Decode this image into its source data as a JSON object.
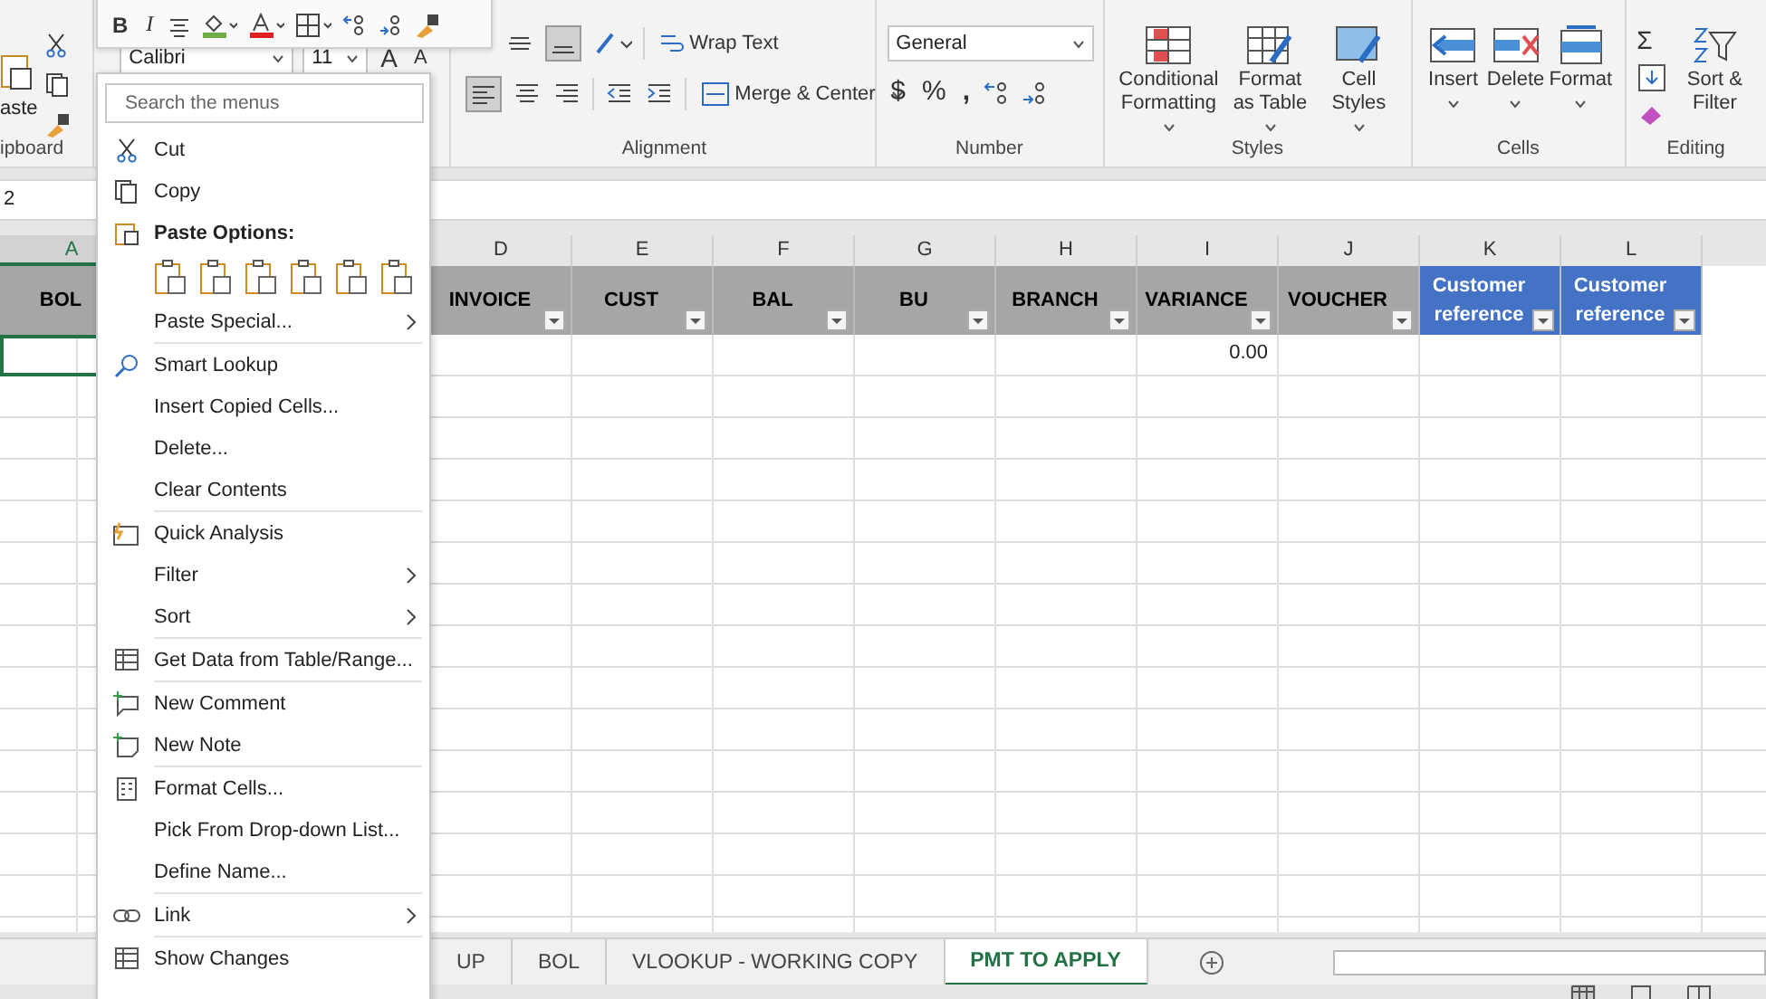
{
  "ribbon": {
    "clipboard": {
      "paste_label": "aste",
      "group_label": "ipboard"
    },
    "font": {
      "font_name": "Calibri",
      "font_size": "11",
      "grow": "A",
      "shrink": "A"
    },
    "alignment": {
      "wrap_text": "Wrap Text",
      "merge": "Merge & Center",
      "group_label": "Alignment"
    },
    "number": {
      "format": "General",
      "currency": "$",
      "percent": "%",
      "comma": ",",
      "group_label": "Number"
    },
    "styles": {
      "buttons": [
        {
          "label": "Conditional Formatting"
        },
        {
          "label": "Format as Table"
        },
        {
          "label": "Cell Styles"
        }
      ],
      "group_label": "Styles"
    },
    "cells": {
      "buttons": [
        {
          "label": "Insert"
        },
        {
          "label": "Delete"
        },
        {
          "label": "Format"
        }
      ],
      "group_label": "Cells"
    },
    "editing": {
      "sigma": "Σ",
      "sort_filter": "Sort & Filter",
      "group_label": "Editing"
    }
  },
  "mini_toolbar": {
    "bold": "B",
    "italic": "I"
  },
  "name_box": "2",
  "columns": [
    {
      "letter": "A",
      "header": "BOL",
      "color": "#a6a6a6",
      "selected": true
    },
    {
      "letter": "D",
      "header": "INVOICE",
      "color": "#a6a6a6",
      "selected": false
    },
    {
      "letter": "E",
      "header": "CUST",
      "color": "#a6a6a6",
      "selected": false
    },
    {
      "letter": "F",
      "header": "BAL",
      "color": "#a6a6a6",
      "selected": false
    },
    {
      "letter": "G",
      "header": "BU",
      "color": "#a6a6a6",
      "selected": false
    },
    {
      "letter": "H",
      "header": "BRANCH",
      "color": "#a6a6a6",
      "selected": false
    },
    {
      "letter": "I",
      "header": "VARIANCE",
      "color": "#a6a6a6",
      "selected": false,
      "value": "0.00"
    },
    {
      "letter": "J",
      "header": "VOUCHER",
      "color": "#a6a6a6",
      "selected": false
    },
    {
      "letter": "K",
      "header": "Customer reference",
      "color": "#4472c4",
      "selected": false
    },
    {
      "letter": "L",
      "header": "Customer reference",
      "color": "#4472c4",
      "selected": false
    }
  ],
  "context_menu": {
    "search_placeholder": "Search the menus",
    "sections": [
      [
        {
          "label": "Cut",
          "submenu": false,
          "kind": "item"
        },
        {
          "label": "Copy",
          "submenu": false,
          "kind": "item"
        },
        {
          "label": "Paste Options:",
          "submenu": false,
          "kind": "heading"
        },
        {
          "kind": "paste-icons"
        },
        {
          "label": "Paste Special...",
          "submenu": true,
          "kind": "item"
        }
      ],
      [
        {
          "label": "Smart Lookup",
          "submenu": false,
          "kind": "item"
        },
        {
          "label": "Insert Copied Cells...",
          "submenu": false,
          "kind": "item"
        },
        {
          "label": "Delete...",
          "submenu": false,
          "kind": "item"
        },
        {
          "label": "Clear Contents",
          "submenu": false,
          "kind": "item"
        }
      ],
      [
        {
          "label": "Quick Analysis",
          "submenu": false,
          "kind": "item"
        },
        {
          "label": "Filter",
          "submenu": true,
          "kind": "item"
        },
        {
          "label": "Sort",
          "submenu": true,
          "kind": "item"
        }
      ],
      [
        {
          "label": "Get Data from Table/Range...",
          "submenu": false,
          "kind": "item"
        }
      ],
      [
        {
          "label": "New Comment",
          "submenu": false,
          "kind": "item"
        },
        {
          "label": "New Note",
          "submenu": false,
          "kind": "item"
        }
      ],
      [
        {
          "label": "Format Cells...",
          "submenu": false,
          "kind": "item"
        },
        {
          "label": "Pick From Drop-down List...",
          "submenu": false,
          "kind": "item"
        },
        {
          "label": "Define Name...",
          "submenu": false,
          "kind": "item"
        }
      ],
      [
        {
          "label": "Link",
          "submenu": true,
          "kind": "item"
        }
      ],
      [
        {
          "label": "Show Changes",
          "submenu": false,
          "kind": "item"
        }
      ]
    ]
  },
  "sheet_tabs": [
    {
      "label": "UP",
      "selected": false
    },
    {
      "label": "BOL",
      "selected": false
    },
    {
      "label": "VLOOKUP - WORKING COPY",
      "selected": false
    },
    {
      "label": "PMT TO APPLY",
      "selected": true
    }
  ]
}
